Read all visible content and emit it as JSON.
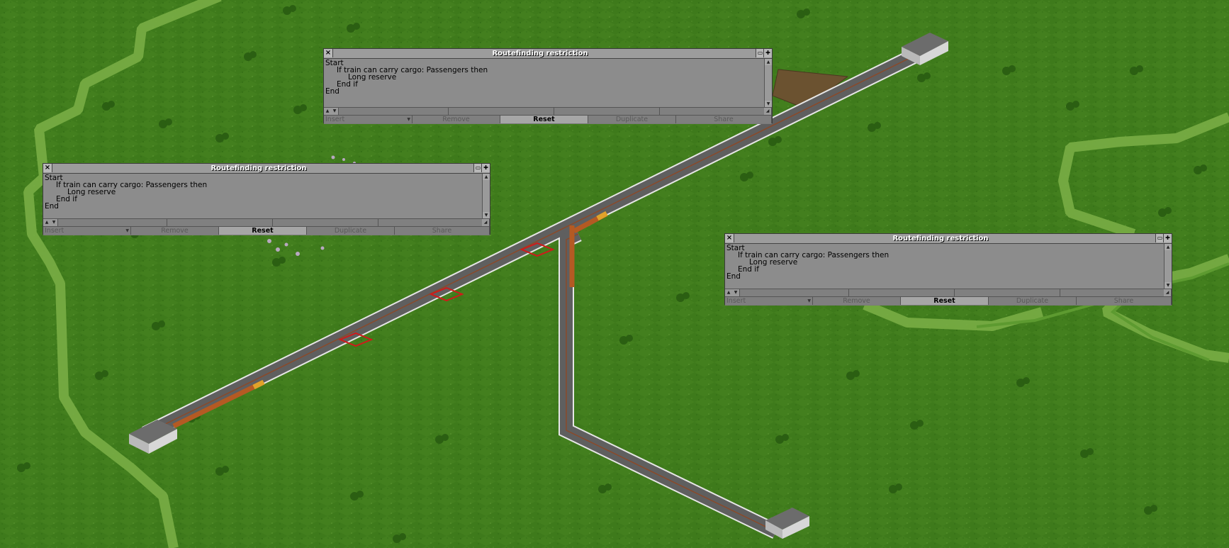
{
  "windows": [
    {
      "title": "Routefinding restriction",
      "lines": [
        "Start",
        "If train can carry cargo: Passengers then",
        "Long reserve",
        "End if",
        "End"
      ],
      "buttons": {
        "insert": "Insert",
        "remove": "Remove",
        "reset": "Reset",
        "duplicate": "Duplicate",
        "share": "Share"
      }
    },
    {
      "title": "Routefinding restriction",
      "lines": [
        "Start",
        "If train can carry cargo: Passengers then",
        "Long reserve",
        "End if",
        "End"
      ],
      "buttons": {
        "insert": "Insert",
        "remove": "Remove",
        "reset": "Reset",
        "duplicate": "Duplicate",
        "share": "Share"
      }
    },
    {
      "title": "Routefinding restriction",
      "lines": [
        "Start",
        "If train can carry cargo: Passengers then",
        "Long reserve",
        "End if",
        "End"
      ],
      "buttons": {
        "insert": "Insert",
        "remove": "Remove",
        "reset": "Reset",
        "duplicate": "Duplicate",
        "share": "Share"
      }
    }
  ],
  "icons": {
    "close": "close-icon",
    "shade": "shade-window-icon",
    "sticky": "pin-icon",
    "resize": "resize-icon",
    "scroll_up": "scroll-up-icon",
    "scroll_down": "scroll-down-icon",
    "dropdown": "dropdown-arrow-icon"
  },
  "colors": {
    "grass": "#3f7a1c",
    "grass_light": "#7fb04a",
    "track_bed": "#5b5b5b",
    "rail_fence": "#dcdcdc",
    "signal_marker": "#d01a1a",
    "window_bg": "#8c8c8c",
    "title_text": "#ffffff"
  }
}
